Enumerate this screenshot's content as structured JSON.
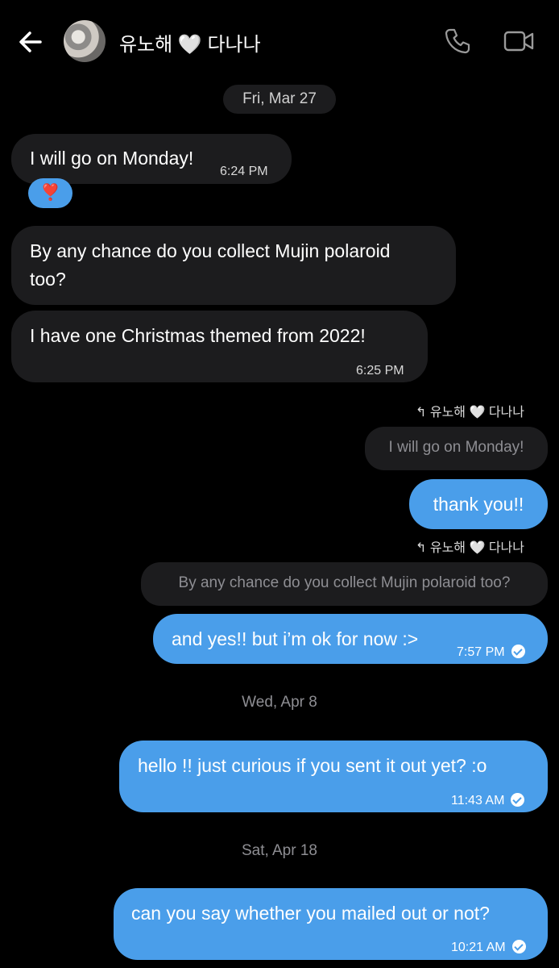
{
  "header": {
    "contact_name": "유노해 🤍 다나나",
    "back_icon": "arrow-left-icon",
    "phone_icon": "phone-icon",
    "video_icon": "video-camera-icon"
  },
  "colors": {
    "background": "#000000",
    "incoming_bubble": "#1c1c1e",
    "outgoing_bubble": "#4a9eea",
    "muted_text": "#8e8e93"
  },
  "conversation": {
    "date_1": "Fri, Mar 27",
    "msg_1": {
      "text": "I will go on Monday!",
      "time": "6:24 PM",
      "reaction": "❣️"
    },
    "msg_2": {
      "text_line1": "By any chance do you collect Mujin polaroid",
      "text_line2": "too?"
    },
    "msg_3": {
      "text": "I have one  Christmas themed from 2022!",
      "time": "6:25 PM"
    },
    "reply_1": {
      "label": "↰ 유노해 🤍 다나나",
      "quoted": "I will go on Monday!",
      "text": "thank you!!"
    },
    "reply_2": {
      "label": "↰ 유노해 🤍 다나나",
      "quoted": "By any chance do you collect Mujin polaroid too?",
      "text": "and yes!! but i’m ok for now :>",
      "time": "7:57 PM"
    },
    "date_2": "Wed, Apr 8",
    "msg_4": {
      "text": "hello !! just curious if you sent it out yet? :o",
      "time": "11:43 AM"
    },
    "date_3": "Sat, Apr 18",
    "msg_5": {
      "text": "can you say whether you mailed out or not?",
      "time": "10:21 AM"
    }
  }
}
